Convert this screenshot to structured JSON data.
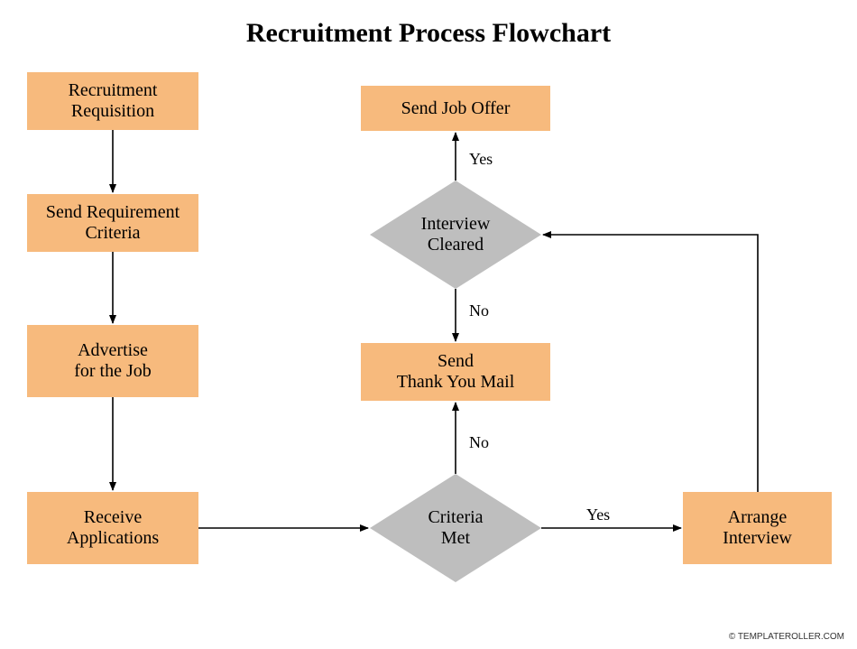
{
  "title": "Recruitment Process Flowchart",
  "footer": "© TEMPLATEROLLER.COM",
  "colors": {
    "box": "#f7ba7d",
    "diamond": "#bebebe"
  },
  "nodes": {
    "recruitment_requisition": "Recruitment\nRequisition",
    "send_requirement_criteria": "Send Requirement\nCriteria",
    "advertise_for_the_job": "Advertise\nfor the Job",
    "receive_applications": "Receive\nApplications",
    "criteria_met": "Criteria\nMet",
    "arrange_interview": "Arrange\nInterview",
    "interview_cleared": "Interview\nCleared",
    "send_job_offer": "Send Job Offer",
    "send_thank_you_mail": "Send\nThank You Mail"
  },
  "edge_labels": {
    "criteria_met_yes": "Yes",
    "criteria_met_no": "No",
    "interview_cleared_yes": "Yes",
    "interview_cleared_no": "No"
  },
  "chart_data": {
    "type": "flowchart",
    "title": "Recruitment Process Flowchart",
    "nodes": [
      {
        "id": "recruitment_requisition",
        "shape": "process",
        "label": "Recruitment Requisition"
      },
      {
        "id": "send_requirement_criteria",
        "shape": "process",
        "label": "Send Requirement Criteria"
      },
      {
        "id": "advertise_for_the_job",
        "shape": "process",
        "label": "Advertise for the Job"
      },
      {
        "id": "receive_applications",
        "shape": "process",
        "label": "Receive Applications"
      },
      {
        "id": "criteria_met",
        "shape": "decision",
        "label": "Criteria Met"
      },
      {
        "id": "arrange_interview",
        "shape": "process",
        "label": "Arrange Interview"
      },
      {
        "id": "interview_cleared",
        "shape": "decision",
        "label": "Interview Cleared"
      },
      {
        "id": "send_job_offer",
        "shape": "process",
        "label": "Send Job Offer"
      },
      {
        "id": "send_thank_you_mail",
        "shape": "process",
        "label": "Send Thank You Mail"
      }
    ],
    "edges": [
      {
        "from": "recruitment_requisition",
        "to": "send_requirement_criteria"
      },
      {
        "from": "send_requirement_criteria",
        "to": "advertise_for_the_job"
      },
      {
        "from": "advertise_for_the_job",
        "to": "receive_applications"
      },
      {
        "from": "receive_applications",
        "to": "criteria_met"
      },
      {
        "from": "criteria_met",
        "to": "arrange_interview",
        "label": "Yes"
      },
      {
        "from": "criteria_met",
        "to": "send_thank_you_mail",
        "label": "No"
      },
      {
        "from": "arrange_interview",
        "to": "interview_cleared"
      },
      {
        "from": "interview_cleared",
        "to": "send_job_offer",
        "label": "Yes"
      },
      {
        "from": "interview_cleared",
        "to": "send_thank_you_mail",
        "label": "No"
      }
    ]
  }
}
